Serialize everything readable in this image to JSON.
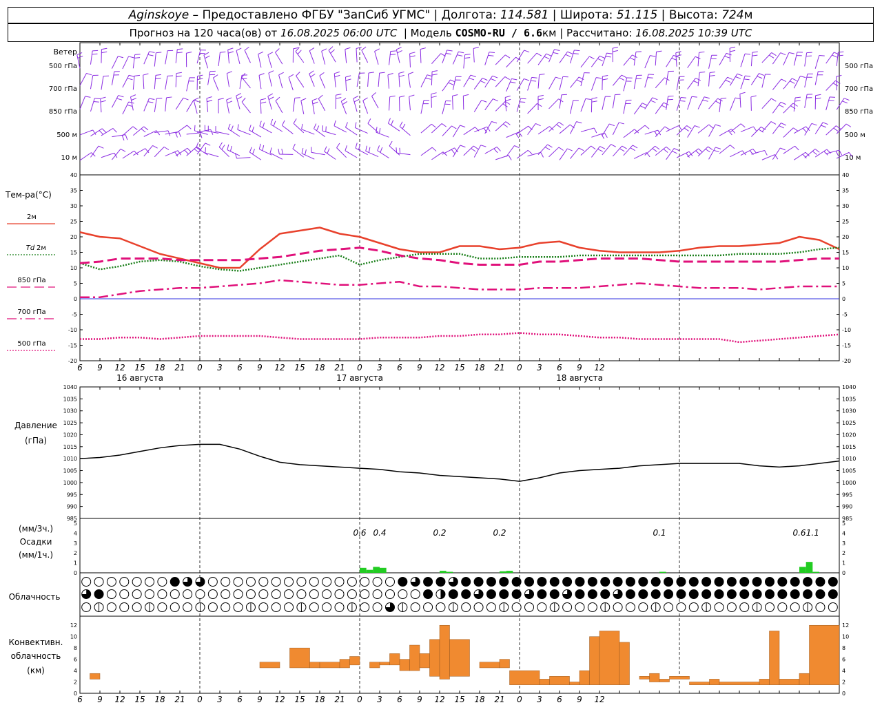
{
  "header": {
    "station": "Aginskoye",
    "provider": "Предоставлено ФГБУ \"ЗапСиб УГМС\"",
    "lon_label": "Долгота:",
    "lon_value": "114.581",
    "lat_label": "Широта:",
    "lat_value": "51.115",
    "alt_label": "Высота:",
    "alt_value": "724",
    "alt_unit": "м",
    "forecast_label": "Прогноз на 120 часа(ов) от",
    "forecast_time": "16.08.2025 06:00 UTC",
    "model_label": "Модель",
    "model_value": "COSMO-RU / 6.6",
    "model_unit": "км",
    "calc_label": "Рассчитано:",
    "calc_time": "16.08.2025 10:39 UTC"
  },
  "colors": {
    "wind_barb": "#8a2be2",
    "t2m": "#e8412c",
    "td2m": "#1a7f1a",
    "t850": "#e0107a",
    "t700": "#e0107a",
    "t500": "#e0107a",
    "zero_line": "#3030e0",
    "precip": "#22cc22",
    "convective": "#f08a30",
    "pressure": "#000000"
  },
  "chart_data": [
    {
      "type": "wind_barbs",
      "title": "Ветер",
      "levels": [
        "500 гПа",
        "700 гПа",
        "850 гПа",
        "500 м",
        "10 м"
      ],
      "x_hours": [
        0,
        114
      ]
    },
    {
      "type": "line",
      "title": "Тем-ра(°С)",
      "ylim": [
        -20,
        40
      ],
      "yticks": [
        40,
        35,
        30,
        25,
        20,
        15,
        10,
        5,
        0,
        -5,
        -10,
        -15,
        -20
      ],
      "x_hours": [
        0,
        3,
        6,
        9,
        12,
        15,
        18,
        21,
        24,
        27,
        30,
        33,
        36,
        39,
        42,
        45,
        48,
        51,
        54,
        57,
        60,
        63,
        66,
        69,
        72,
        75,
        78,
        81,
        84,
        87,
        90,
        93,
        96,
        99,
        102,
        105,
        108,
        111,
        114
      ],
      "series": [
        {
          "name": "2м",
          "style": "solid",
          "values": [
            21.5,
            20,
            19.5,
            17,
            14.5,
            13,
            11.5,
            10,
            10,
            16,
            21,
            22,
            23,
            21,
            20,
            18,
            16,
            15,
            15,
            17,
            17,
            16,
            16.5,
            18,
            18.5,
            16.5,
            15.5,
            15,
            15,
            15,
            15.5,
            16.5,
            17,
            17,
            17.5,
            18,
            20,
            19,
            16
          ]
        },
        {
          "name": "Td 2м",
          "label_prefix": "Td",
          "label_suffix": "2м",
          "style": "dotted",
          "values": [
            11.5,
            9.5,
            10.5,
            12,
            12.5,
            12,
            10.5,
            9.5,
            9,
            10,
            11,
            12,
            13,
            14,
            11,
            12.5,
            13.5,
            14.5,
            14.5,
            14.5,
            13,
            13,
            13.5,
            13.5,
            13.5,
            14,
            14,
            14,
            14,
            14,
            14,
            14,
            14,
            14.5,
            14.5,
            14.5,
            15,
            16,
            16.5
          ]
        },
        {
          "name": "850 гПа",
          "style": "dashed",
          "values": [
            11.5,
            12,
            13,
            13,
            13,
            12.5,
            12.5,
            12.5,
            12.5,
            13,
            13.5,
            14.5,
            15.5,
            16,
            16.5,
            15.5,
            14,
            13,
            12.5,
            11.5,
            11,
            11,
            11,
            12,
            12,
            12.5,
            13,
            13,
            13,
            12.5,
            12,
            12,
            12,
            12,
            12,
            12,
            12.5,
            13,
            13
          ]
        },
        {
          "name": "700 гПа",
          "style": "dashdot",
          "values": [
            0.5,
            0.5,
            1.5,
            2.5,
            3,
            3.5,
            3.5,
            4,
            4.5,
            5,
            6,
            5.5,
            5,
            4.5,
            4.5,
            5,
            5.5,
            4,
            4,
            3.5,
            3,
            3,
            3,
            3.5,
            3.5,
            3.5,
            4,
            4.5,
            5,
            4.5,
            4,
            3.5,
            3.5,
            3.5,
            3,
            3.5,
            4,
            4,
            4
          ]
        },
        {
          "name": "500 гПа",
          "style": "dotted",
          "values": [
            -13,
            -13,
            -12.5,
            -12.5,
            -13,
            -12.5,
            -12,
            -12,
            -12,
            -12,
            -12.5,
            -13,
            -13,
            -13,
            -13,
            -12.5,
            -12.5,
            -12.5,
            -12,
            -12,
            -11.5,
            -11.5,
            -11,
            -11.5,
            -11.5,
            -12,
            -12.5,
            -12.5,
            -13,
            -13,
            -13,
            -13,
            -13,
            -14,
            -13.5,
            -13,
            -12.5,
            -12,
            -11.5
          ]
        }
      ]
    },
    {
      "type": "line",
      "title": "Давление",
      "ylabel": "(гПа)",
      "ylim": [
        985,
        1040
      ],
      "yticks": [
        1040,
        1035,
        1030,
        1025,
        1020,
        1015,
        1010,
        1005,
        1000,
        995,
        990,
        985
      ],
      "x_hours": [
        0,
        3,
        6,
        9,
        12,
        15,
        18,
        21,
        24,
        27,
        30,
        33,
        36,
        39,
        42,
        45,
        48,
        51,
        54,
        57,
        60,
        63,
        66,
        69,
        72,
        75,
        78,
        81,
        84,
        87,
        90,
        93,
        96,
        99,
        102,
        105,
        108,
        111,
        114
      ],
      "series": [
        {
          "name": "pressure",
          "values": [
            1010,
            1010.5,
            1011.5,
            1013,
            1014.5,
            1015.5,
            1016,
            1016,
            1014,
            1011,
            1008.5,
            1007.5,
            1007,
            1006.5,
            1006,
            1005.5,
            1004.5,
            1004,
            1003,
            1002.5,
            1002,
            1001.5,
            1000.5,
            1002,
            1004,
            1005,
            1005.5,
            1006,
            1007,
            1007.5,
            1008,
            1008,
            1008,
            1008,
            1007,
            1006.5,
            1007,
            1008,
            1009
          ]
        }
      ]
    },
    {
      "type": "bar",
      "title": "Осадки",
      "ylabel_top": "(мм/3ч.)",
      "ylabel_bottom": "(мм/1ч.)",
      "ylim": [
        0,
        5
      ],
      "yticks": [
        5,
        4,
        3,
        2,
        1,
        0
      ],
      "bars": [
        {
          "h": 42,
          "v": 0.5
        },
        {
          "h": 43,
          "v": 0.3
        },
        {
          "h": 44,
          "v": 0.6
        },
        {
          "h": 45,
          "v": 0.5
        },
        {
          "h": 54,
          "v": 0.2
        },
        {
          "h": 55,
          "v": 0.1
        },
        {
          "h": 63,
          "v": 0.15
        },
        {
          "h": 64,
          "v": 0.2
        },
        {
          "h": 87,
          "v": 0.1
        },
        {
          "h": 108,
          "v": 0.6
        },
        {
          "h": 109,
          "v": 1.1
        },
        {
          "h": 110,
          "v": 0.1
        }
      ],
      "labels": [
        {
          "h": 42,
          "text": "0.6"
        },
        {
          "h": 45,
          "text": "0.4"
        },
        {
          "h": 54,
          "text": "0.2"
        },
        {
          "h": 63,
          "text": "0.2"
        },
        {
          "h": 87,
          "text": "0.1"
        },
        {
          "h": 108,
          "text": "0.6"
        },
        {
          "h": 110,
          "text": "1.1"
        }
      ]
    },
    {
      "type": "cloud_symbols",
      "title": "Облачность",
      "rows": [
        "0000000F33000000000000000F3FF3FFFFFFFFFFFFFFFFFFFFFFFFFFFFFF",
        "3F0000000000000000000000000F2FF3FFF3FF3FFF3FFFFFFFFFFFFFFFFF",
        "0000000000000000000000003000000000000000000000000000000000000"
      ]
    },
    {
      "type": "bar",
      "title": "Конвективн. облачность",
      "ylabel": "(км)",
      "ylim": [
        0,
        13
      ],
      "yticks": [
        12,
        10,
        8,
        6,
        4,
        2,
        0
      ],
      "bars": [
        {
          "h0": 1,
          "h1": 2,
          "base": 2.5,
          "top": 3.5
        },
        {
          "h0": 18,
          "h1": 20,
          "base": 4.5,
          "top": 5.5
        },
        {
          "h0": 21,
          "h1": 23,
          "base": 4.5,
          "top": 8
        },
        {
          "h0": 23,
          "h1": 24,
          "base": 4.5,
          "top": 5.5
        },
        {
          "h0": 24,
          "h1": 26,
          "base": 4.5,
          "top": 5.5
        },
        {
          "h0": 26,
          "h1": 27,
          "base": 4.5,
          "top": 6
        },
        {
          "h0": 27,
          "h1": 28,
          "base": 5,
          "top": 6.5
        },
        {
          "h0": 29,
          "h1": 30,
          "base": 4.5,
          "top": 5.5
        },
        {
          "h0": 30,
          "h1": 31,
          "base": 5,
          "top": 5.5
        },
        {
          "h0": 31,
          "h1": 32,
          "base": 5,
          "top": 7
        },
        {
          "h0": 32,
          "h1": 33,
          "base": 4,
          "top": 6
        },
        {
          "h0": 33,
          "h1": 34,
          "base": 4,
          "top": 8.5
        },
        {
          "h0": 34,
          "h1": 35,
          "base": 4.5,
          "top": 7
        },
        {
          "h0": 35,
          "h1": 36,
          "base": 3,
          "top": 9.5
        },
        {
          "h0": 36,
          "h1": 37,
          "base": 2.5,
          "top": 12
        },
        {
          "h0": 37,
          "h1": 39,
          "base": 3,
          "top": 9.5
        },
        {
          "h0": 40,
          "h1": 42,
          "base": 4.5,
          "top": 5.5
        },
        {
          "h0": 42,
          "h1": 43,
          "base": 4.5,
          "top": 6
        },
        {
          "h0": 43,
          "h1": 46,
          "base": 1.5,
          "top": 4
        },
        {
          "h0": 46,
          "h1": 47,
          "base": 1.5,
          "top": 2.5
        },
        {
          "h0": 47,
          "h1": 49,
          "base": 1.5,
          "top": 3
        },
        {
          "h0": 49,
          "h1": 50,
          "base": 1.5,
          "top": 2
        },
        {
          "h0": 50,
          "h1": 51,
          "base": 1.5,
          "top": 4
        },
        {
          "h0": 51,
          "h1": 52,
          "base": 1.5,
          "top": 10
        },
        {
          "h0": 52,
          "h1": 54,
          "base": 1.5,
          "top": 11
        },
        {
          "h0": 54,
          "h1": 55,
          "base": 1.5,
          "top": 9
        },
        {
          "h0": 56,
          "h1": 57,
          "base": 2.5,
          "top": 3
        },
        {
          "h0": 57,
          "h1": 58,
          "base": 2,
          "top": 3.5
        },
        {
          "h0": 58,
          "h1": 59,
          "base": 2,
          "top": 2.5
        },
        {
          "h0": 59,
          "h1": 61,
          "base": 2.5,
          "top": 3
        },
        {
          "h0": 61,
          "h1": 63,
          "base": 1.5,
          "top": 2
        },
        {
          "h0": 63,
          "h1": 64,
          "base": 1.5,
          "top": 2.5
        },
        {
          "h0": 64,
          "h1": 68,
          "base": 1.5,
          "top": 2
        },
        {
          "h0": 68,
          "h1": 69,
          "base": 1.5,
          "top": 2.5
        },
        {
          "h0": 69,
          "h1": 70,
          "base": 1.5,
          "top": 11
        },
        {
          "h0": 70,
          "h1": 72,
          "base": 1.5,
          "top": 2.5
        },
        {
          "h0": 72,
          "h1": 73,
          "base": 1.5,
          "top": 3.5
        },
        {
          "h0": 73,
          "h1": 76,
          "base": 1.5,
          "top": 12
        }
      ]
    }
  ],
  "axis": {
    "hour_labels": [
      "6",
      "9",
      "12",
      "15",
      "18",
      "21",
      "0",
      "3",
      "6",
      "9",
      "12",
      "15",
      "18",
      "21",
      "0",
      "3",
      "6",
      "9",
      "12",
      "15",
      "18",
      "21",
      "0",
      "3",
      "6",
      "9",
      "12"
    ],
    "day_labels": [
      "16 августа",
      "17 августа",
      "18 августа"
    ]
  }
}
